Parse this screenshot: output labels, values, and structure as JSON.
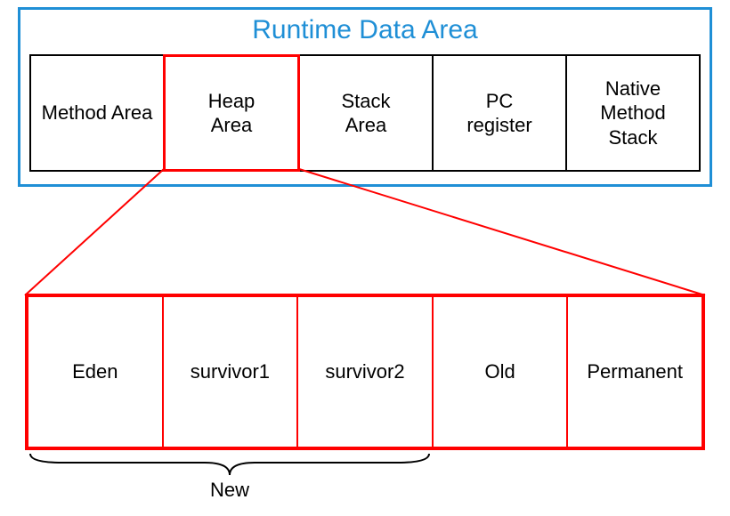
{
  "title": "Runtime Data Area",
  "runtime_areas": [
    {
      "label": "Method Area"
    },
    {
      "label": "Heap\nArea"
    },
    {
      "label": "Stack\nArea"
    },
    {
      "label": "PC\nregister"
    },
    {
      "label": "Native\nMethod\nStack"
    }
  ],
  "heap_regions": [
    {
      "label": "Eden"
    },
    {
      "label": "survivor1"
    },
    {
      "label": "survivor2"
    },
    {
      "label": "Old"
    },
    {
      "label": "Permanent"
    }
  ],
  "brace_new_label": "New"
}
